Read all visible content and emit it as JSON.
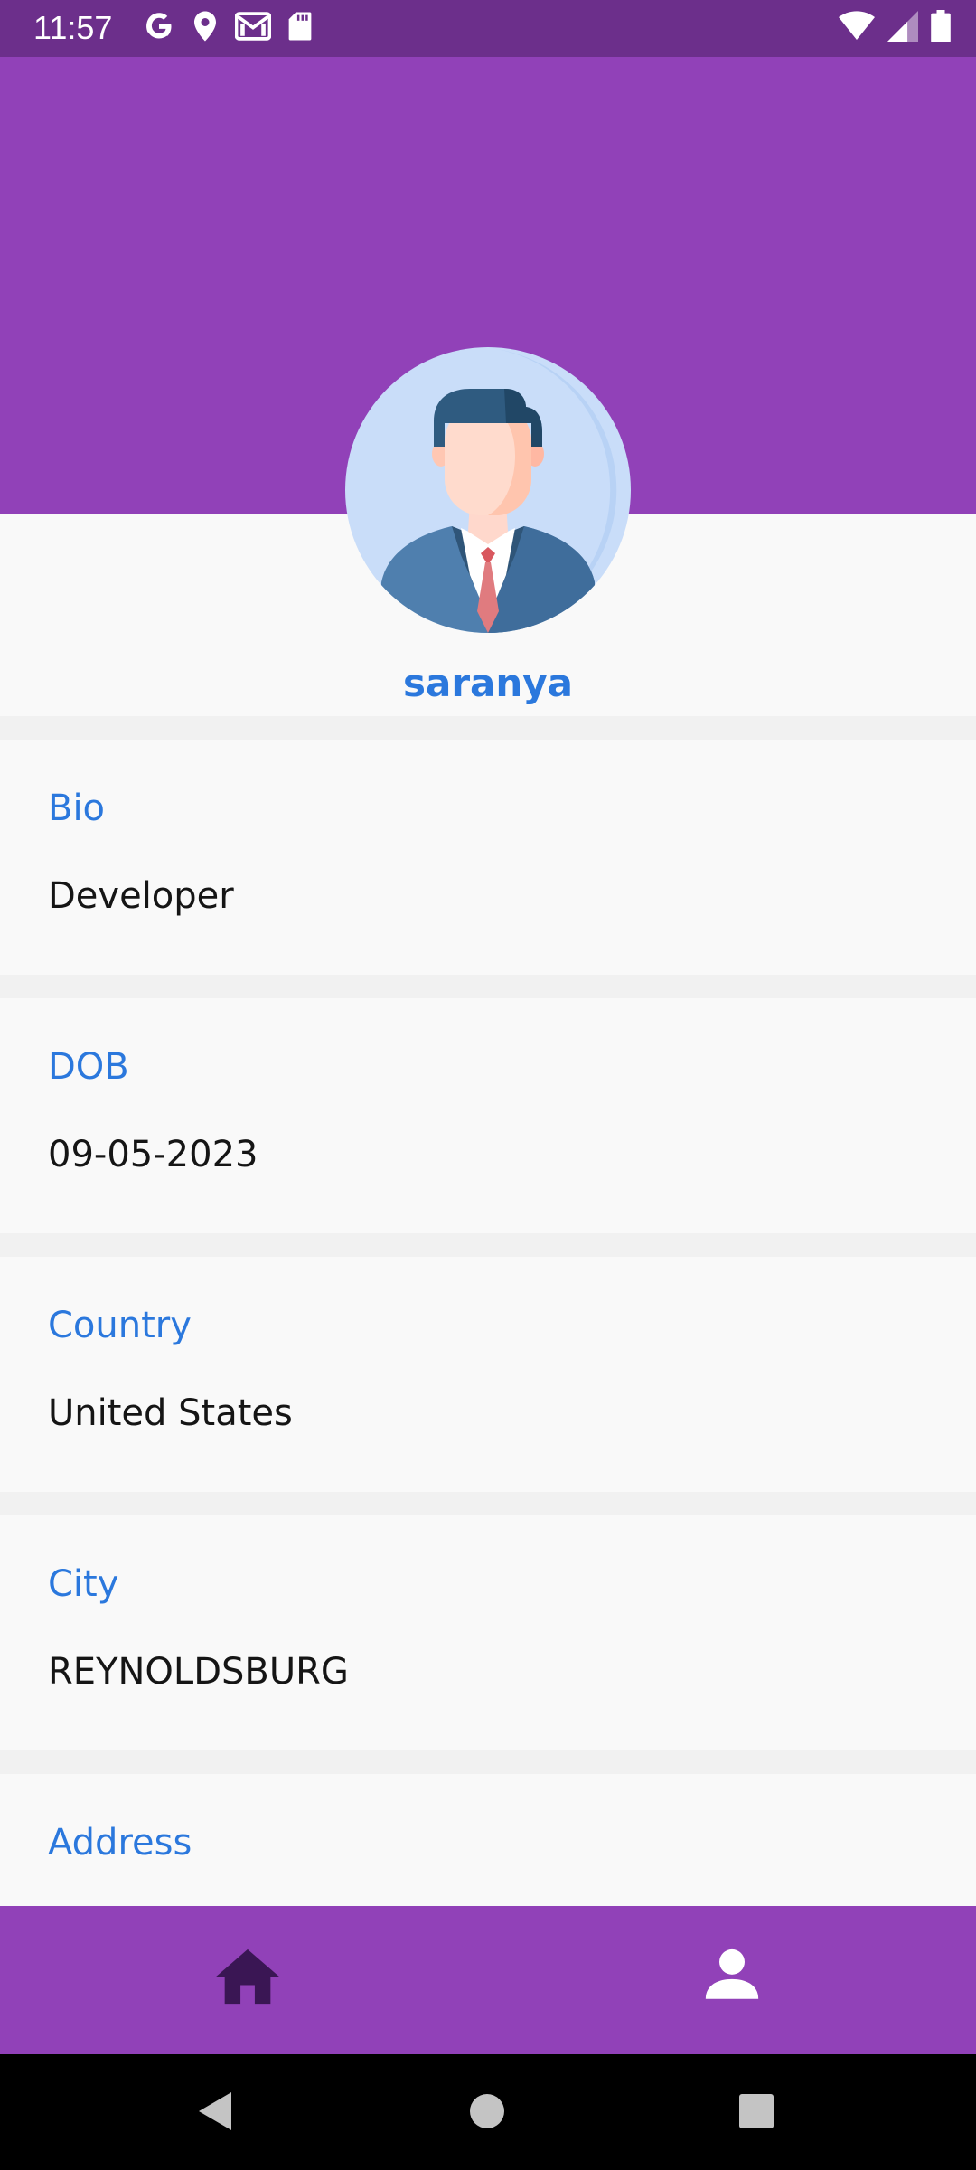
{
  "status_bar": {
    "time": "11:57",
    "left_icons": [
      "google-icon",
      "location-icon",
      "gmail-icon",
      "sd-card-icon"
    ],
    "right_icons": [
      "wifi-icon",
      "signal-icon",
      "battery-icon"
    ]
  },
  "colors": {
    "status_bar": "#6c2f8b",
    "primary": "#9141b8",
    "accent_text": "#2b78dd",
    "card_bg": "#f9f9f9",
    "separator_bg": "#f1f1f1"
  },
  "profile": {
    "name": "saranya",
    "avatar_icon": "businessman-avatar-icon"
  },
  "fields": [
    {
      "label": "Bio",
      "value": "Developer"
    },
    {
      "label": "DOB",
      "value": "09-05-2023"
    },
    {
      "label": "Country",
      "value": "United States"
    },
    {
      "label": "City",
      "value": "REYNOLDSBURG"
    },
    {
      "label": "Address",
      "value": ""
    }
  ],
  "bottom_nav": {
    "items": [
      {
        "icon": "home-icon",
        "selected": true
      },
      {
        "icon": "person-icon",
        "selected": false
      }
    ]
  },
  "system_nav": {
    "icons": [
      "back-icon",
      "home-circle-icon",
      "recents-icon"
    ]
  }
}
